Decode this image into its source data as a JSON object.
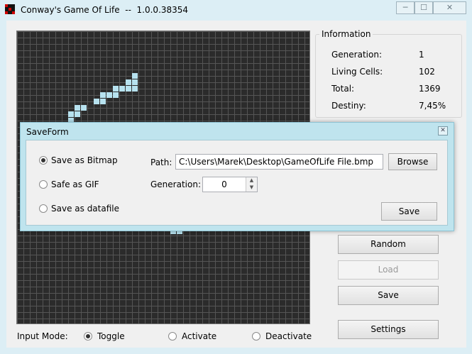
{
  "window": {
    "title": "Conway's Game Of Life  --  1.0.0.38354",
    "minimize": "─",
    "maximize": "☐",
    "close": "✕"
  },
  "information": {
    "title": "Information",
    "rows": [
      {
        "label": "Generation:",
        "value": "1"
      },
      {
        "label": "Living Cells:",
        "value": "102"
      },
      {
        "label": "Total:",
        "value": "1369"
      },
      {
        "label": "Destiny:",
        "value": "7,45%"
      }
    ]
  },
  "buttons": {
    "random": "Random",
    "load": "Load",
    "save": "Save",
    "settings": "Settings"
  },
  "input_mode": {
    "label": "Input Mode:",
    "options": [
      "Toggle",
      "Activate",
      "Deactivate"
    ],
    "selected": "Toggle"
  },
  "save_form": {
    "title": "SaveForm",
    "close": "✕",
    "formats": [
      "Save as Bitmap",
      "Safe as GIF",
      "Save as datafile"
    ],
    "selected_format": "Save as Bitmap",
    "path_label": "Path:",
    "path_value": "C:\\Users\\Marek\\Desktop\\GameOfLife File.bmp",
    "browse": "Browse",
    "generation_label": "Generation:",
    "generation_value": "0",
    "save": "Save"
  },
  "colors": {
    "grid_background": "#2b2b2b",
    "living_cell": "#b7e2ef",
    "dialog_frame": "#bfe4ee"
  }
}
